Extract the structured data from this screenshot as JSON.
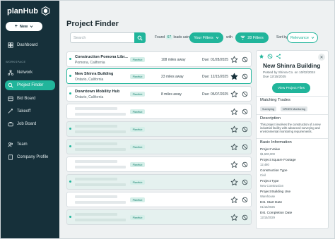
{
  "colors": {
    "accent": "#21b59b",
    "sidebar_bg": "#16303a",
    "main_bg": "#eef1f2"
  },
  "brand": {
    "name": "planHub",
    "icon": "hexagon-logo-icon"
  },
  "sidebar": {
    "new_button": "New",
    "section_label": "WORKSPACE",
    "items": [
      {
        "label": "Dashboard",
        "icon": "dashboard-icon"
      },
      {
        "label": "Network",
        "icon": "network-icon"
      },
      {
        "label": "Project Finder",
        "icon": "search-icon",
        "active": true
      },
      {
        "label": "Bid Board",
        "icon": "board-icon"
      },
      {
        "label": "Takeoff",
        "icon": "takeoff-icon"
      },
      {
        "label": "Job Board",
        "icon": "briefcase-icon"
      },
      {
        "label": "Team",
        "icon": "team-icon"
      },
      {
        "label": "Company Profile",
        "icon": "building-icon"
      }
    ]
  },
  "header": {
    "title": "Project Finder",
    "search_placeholder": "Search",
    "found_prefix": "Found",
    "found_count": "67",
    "found_suffix": "leads using",
    "your_filters": "Your Filters",
    "with": "with",
    "filters_count": "28 Filters",
    "sort_by": "Sort by",
    "sort_value": "Relevance"
  },
  "projects": [
    {
      "name": "Construction Pomona Libr...",
      "location": "Pomona, California",
      "tag": "PlanHub",
      "distance": "108 miles away",
      "due": "Due: 01/28/2025",
      "starred": false
    },
    {
      "name": "New Shinra Building",
      "location": "Ontario, California",
      "tag": "PlanHub",
      "distance": "23 miles away",
      "due": "Due: 12/15/2025",
      "starred": true,
      "selected": true
    },
    {
      "name": "Downtown Mobility Hub",
      "location": "Ontario, California",
      "tag": "PlanHub",
      "distance": "8 miles away",
      "due": "Due: 05/07/2025",
      "starred": false
    },
    {
      "tag": "PlanHub"
    },
    {
      "tag": "PlanHub"
    },
    {
      "tag": "PlanHub"
    },
    {
      "tag": "PlanHub"
    },
    {
      "tag": "PlanHub"
    },
    {
      "tag": "PlanHub"
    },
    {
      "tag": "PlanHub"
    }
  ],
  "detail": {
    "title": "New Shinra Building",
    "posted": "Posted by Shinra Co. on 10/02/2024",
    "due": "Due 12/15/2025",
    "view_button": "View Project Files",
    "trades_heading": "Matching Trades",
    "trades": [
      "Surveying",
      "NPDES Monitoring"
    ],
    "description_heading": "Description",
    "description": "This project involves the construction of a new industrial facility with advanced surveying and environmental monitoring requirements.",
    "basic_heading": "Basic Information",
    "fields": [
      {
        "label": "Project Value",
        "value": "$1,500,000"
      },
      {
        "label": "Project Square Footage",
        "value": "12,480"
      },
      {
        "label": "Construction Type",
        "value": "Civil"
      },
      {
        "label": "Project Type",
        "value": "New Construction"
      },
      {
        "label": "Project Building Use",
        "value": "Warehouse"
      },
      {
        "label": "Est. Start Date",
        "value": "01/15/2025"
      },
      {
        "label": "Est. Completion Date",
        "value": "12/15/2029"
      }
    ]
  }
}
